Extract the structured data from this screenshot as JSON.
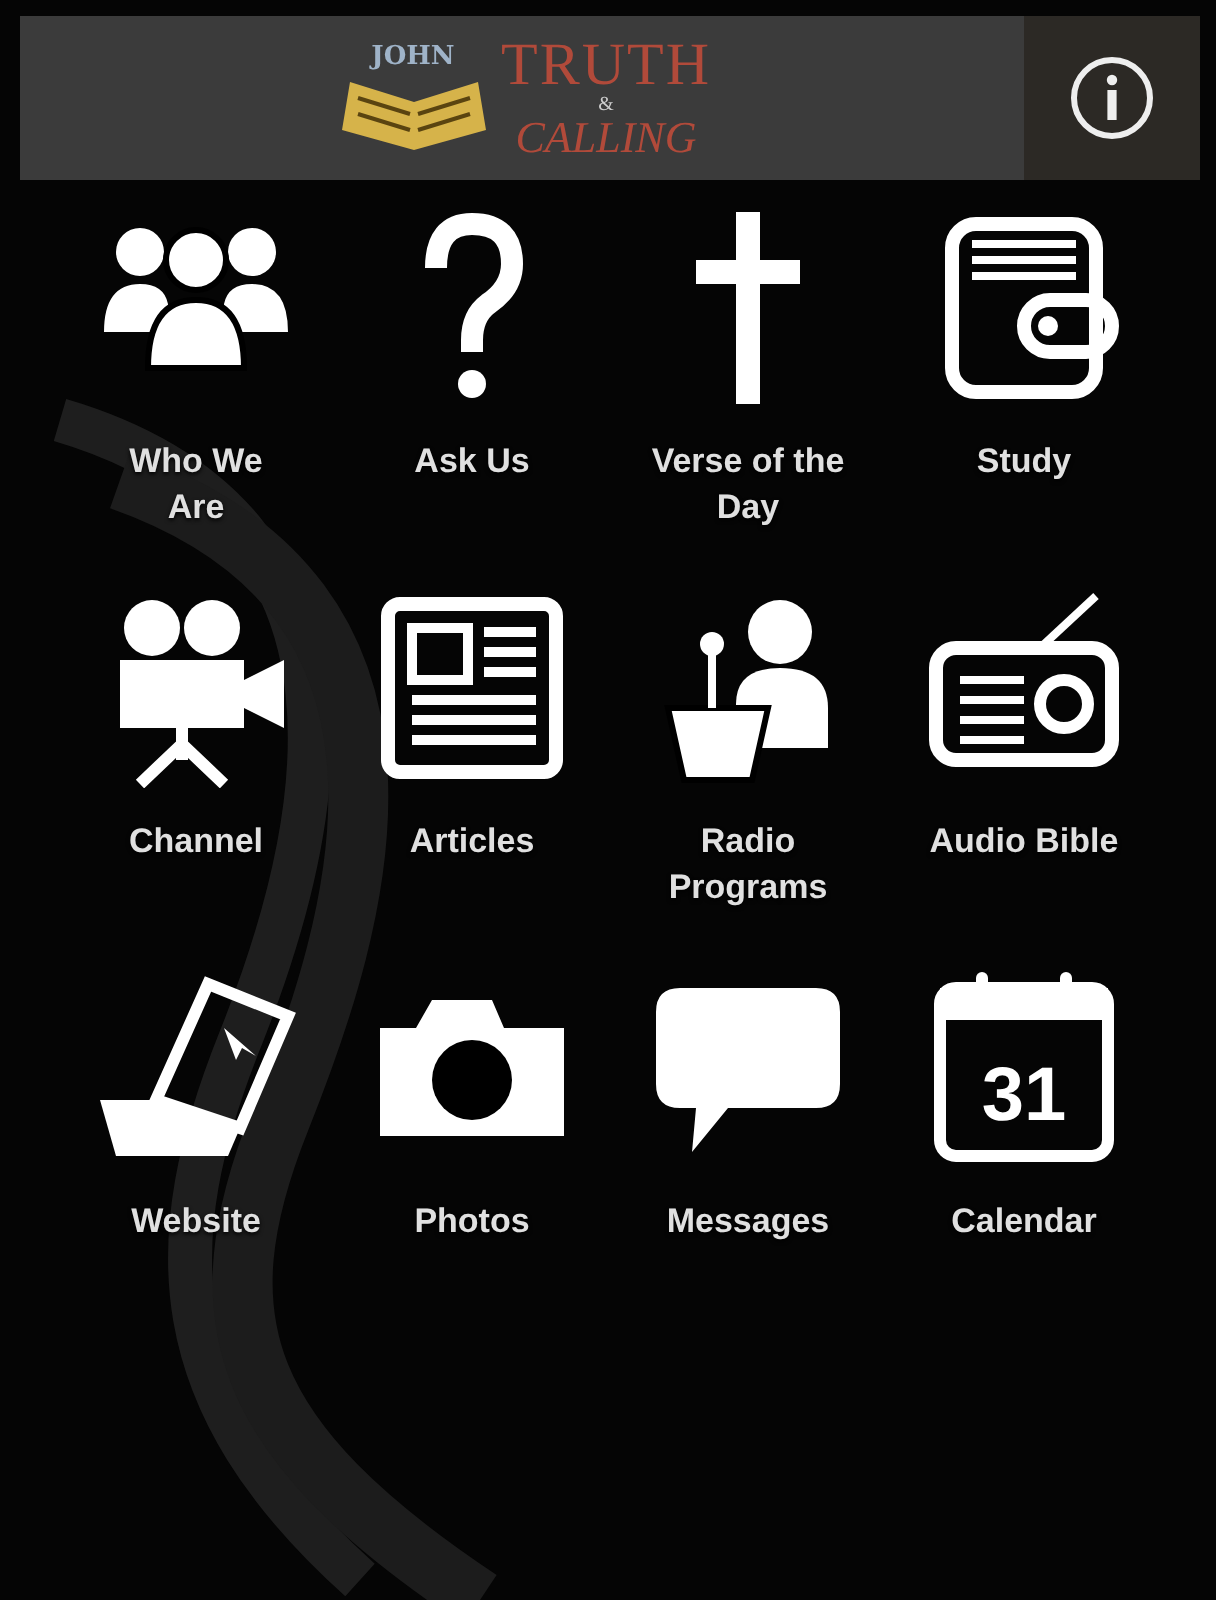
{
  "header": {
    "logo": {
      "top": "JOHN",
      "title": "TRUTH",
      "amp": "&",
      "subtitle": "CALLING"
    }
  },
  "items": [
    {
      "kind": "people",
      "label": "Who We Are"
    },
    {
      "kind": "question",
      "label": "Ask Us"
    },
    {
      "kind": "cross",
      "label": "Verse of the Day"
    },
    {
      "kind": "book",
      "label": "Study"
    },
    {
      "kind": "movie",
      "label": "Channel"
    },
    {
      "kind": "newspaper",
      "label": "Articles"
    },
    {
      "kind": "speaker",
      "label": "Radio Programs"
    },
    {
      "kind": "radio",
      "label": "Audio Bible"
    },
    {
      "kind": "laptop",
      "label": "Website"
    },
    {
      "kind": "camera",
      "label": "Photos"
    },
    {
      "kind": "bubble",
      "label": "Messages"
    },
    {
      "kind": "calendar",
      "label": "Calendar",
      "day": "31"
    }
  ]
}
